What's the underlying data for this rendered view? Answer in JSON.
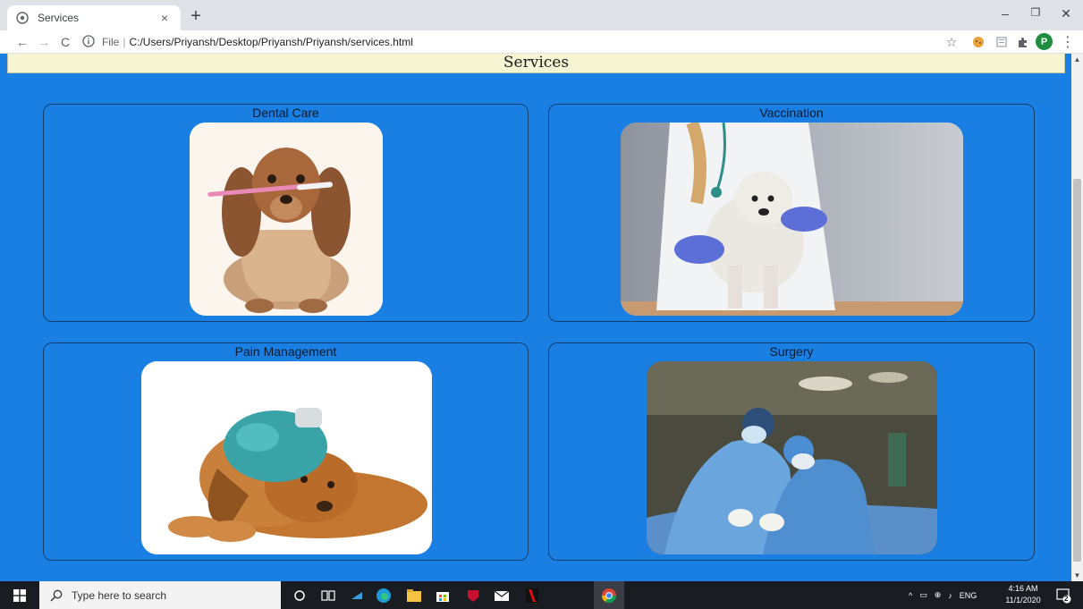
{
  "browser": {
    "tab_title": "Services",
    "tab_close": "×",
    "new_tab": "+",
    "window_controls": {
      "minimize": "–",
      "maximize": "❐",
      "close": "✕"
    },
    "nav": {
      "back": "←",
      "forward": "→",
      "reload": "C"
    },
    "omnibox": {
      "scheme": "File",
      "separator": "|",
      "path": "C:/Users/Priyansh/Desktop/Priyansh/Priyansh/services.html"
    },
    "profile_initial": "P",
    "star_icon": "☆",
    "menu_icon": "⋮"
  },
  "page": {
    "header_title": "Services",
    "services": [
      {
        "title": "Dental Care",
        "image": "dog-with-toothbrush"
      },
      {
        "title": "Vaccination",
        "image": "vet-holding-dog"
      },
      {
        "title": "Pain Management",
        "image": "dog-with-ice-pack"
      },
      {
        "title": "Surgery",
        "image": "surgeons-operating"
      }
    ]
  },
  "taskbar": {
    "search_placeholder": "Type here to search",
    "language": "ENG",
    "time": "4:16 AM",
    "date": "11/1/2020",
    "notification_count": "2"
  },
  "colors": {
    "page_background": "#1a7fe2",
    "header_background": "#f5f4d3",
    "taskbar_background": "#191c21"
  }
}
